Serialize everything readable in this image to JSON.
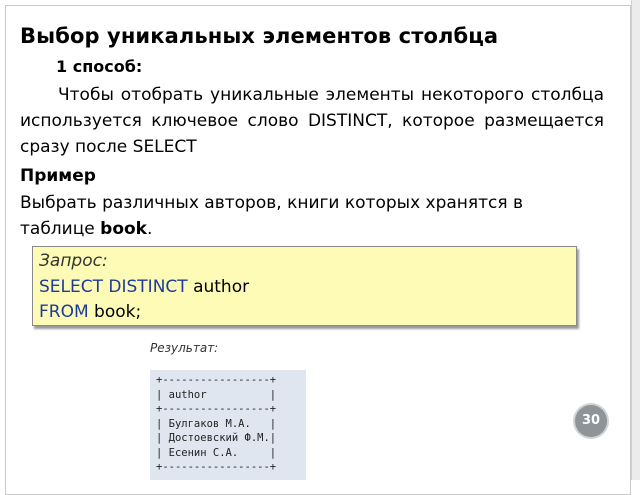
{
  "slide": {
    "title": "Выбор уникальных элементов столбца",
    "method_label": "1 способ:",
    "paragraph": "Чтобы отобрать уникальные элементы некоторого столбца используется ключевое слово DISTINCT, которое размещается сразу после SELECT",
    "example_label": "Пример",
    "task_text": "Выбрать различных авторов, книги которых хранятся в таблице ",
    "task_table": "book",
    "task_end": ".",
    "query": {
      "label": "Запрос:",
      "kw1": "SELECT DISTINCT",
      "col": " author",
      "kw2": "FROM",
      "table": " book;"
    },
    "result": {
      "label": "Результат:",
      "lines": [
        "+-----------------+",
        "| author          |",
        "+-----------------+",
        "| Булгаков М.А.   |",
        "| Достоевский Ф.М.|",
        "| Есенин С.А.     |",
        "+-----------------+"
      ]
    },
    "page_number": "30"
  }
}
